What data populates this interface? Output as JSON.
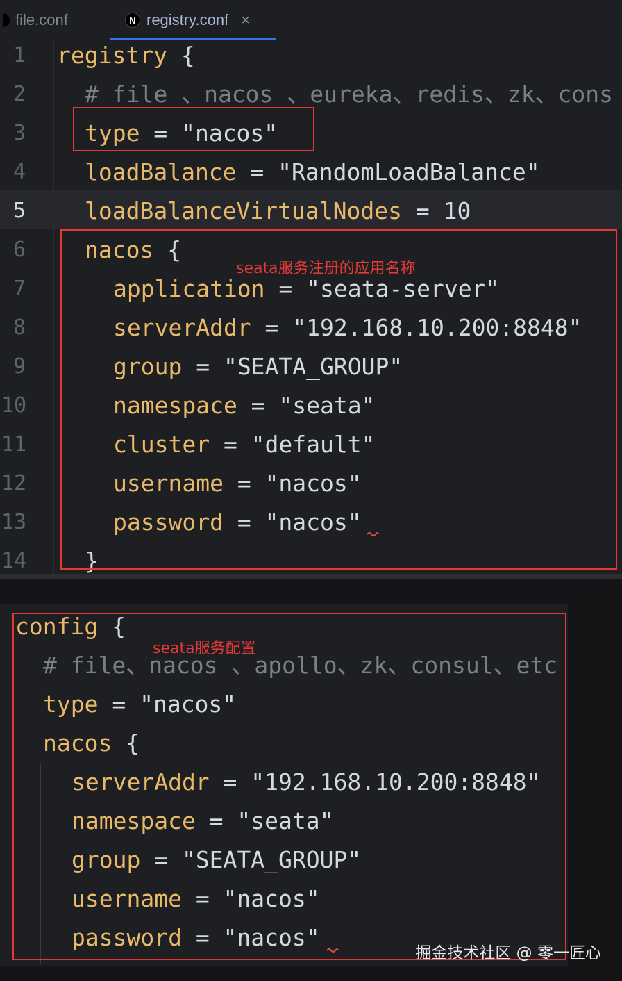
{
  "tabs": [
    {
      "label": "file.conf"
    },
    {
      "label": "registry.conf",
      "icon": "N",
      "close": "×"
    }
  ],
  "editor1": {
    "line_numbers": [
      "1",
      "2",
      "3",
      "4",
      "5",
      "6",
      "7",
      "8",
      "9",
      "10",
      "11",
      "12",
      "13",
      "14"
    ],
    "lines": [
      {
        "key": "registry",
        "rest": " {"
      },
      {
        "comment": "# file 、nacos 、eureka、redis、zk、cons"
      },
      {
        "key": "type",
        "rest": " = \"nacos\""
      },
      {
        "key": "loadBalance",
        "rest": " = \"RandomLoadBalance\""
      },
      {
        "key": "loadBalanceVirtualNodes",
        "rest": " = 10"
      },
      {
        "key": "nacos",
        "rest": " {"
      },
      {
        "key": "application",
        "rest": " = \"seata-server\""
      },
      {
        "key": "serverAddr",
        "rest": " = \"192.168.10.200:8848\""
      },
      {
        "key": "group",
        "rest": " = \"SEATA_GROUP\""
      },
      {
        "key": "namespace",
        "rest": " = \"seata\""
      },
      {
        "key": "cluster",
        "rest": " = \"default\""
      },
      {
        "key": "username",
        "rest": " = \"nacos\""
      },
      {
        "key": "password",
        "rest": " = \"nacos\""
      },
      {
        "rest": "}"
      }
    ],
    "annotation": "seata服务注册的应用名称"
  },
  "editor2": {
    "lines": [
      {
        "key": "config",
        "rest": " {"
      },
      {
        "comment": "# file、nacos 、apollo、zk、consul、etc"
      },
      {
        "key": "type",
        "rest": " = \"nacos\""
      },
      {
        "key": "nacos",
        "rest": " {"
      },
      {
        "key": "serverAddr",
        "rest": " = \"192.168.10.200:8848\""
      },
      {
        "key": "namespace",
        "rest": " = \"seata\""
      },
      {
        "key": "group",
        "rest": " = \"SEATA_GROUP\""
      },
      {
        "key": "username",
        "rest": " = \"nacos\""
      },
      {
        "key": "password",
        "rest": " = \"nacos\""
      }
    ],
    "annotation": "seata服务配置"
  },
  "watermark": "掘金技术社区 @ 零一匠心",
  "colors": {
    "keyword": "#e8b968",
    "text": "#d5d8de",
    "comment": "#7a7e85",
    "highlight_box": "#e53935",
    "tab_underline": "#3574f0"
  }
}
